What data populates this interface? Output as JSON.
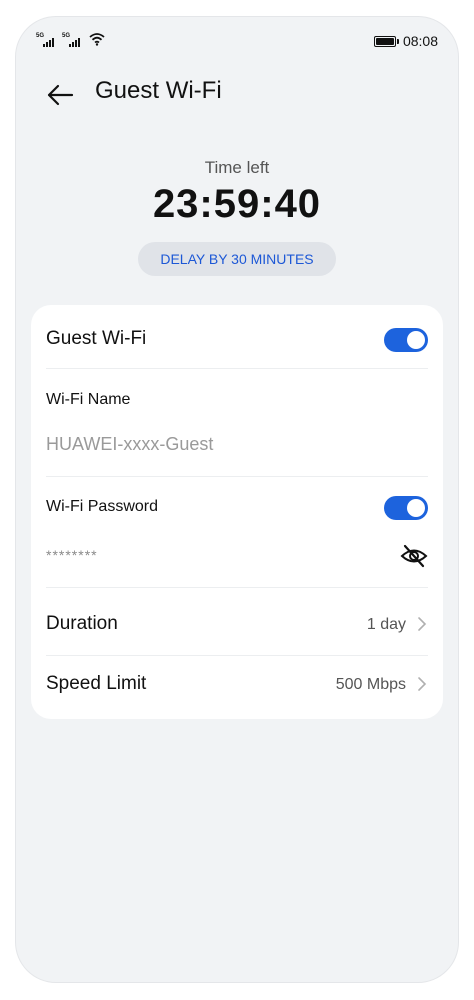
{
  "status_bar": {
    "sim1_tag": "5G",
    "sim2_tag": "5G",
    "time": "08:08",
    "icons": [
      "signal-icon",
      "signal-icon",
      "wifi-icon",
      "battery-icon"
    ]
  },
  "header": {
    "back_icon": "back-arrow-icon",
    "title": "Guest Wi-Fi"
  },
  "timer": {
    "label": "Time left",
    "value": "23:59:40",
    "delay_button": "DELAY BY 30 MINUTES"
  },
  "settings": {
    "guest_wifi": {
      "label": "Guest Wi-Fi",
      "enabled": true
    },
    "wifi_name": {
      "label": "Wi-Fi Name",
      "value": "HUAWEI-xxxx-Guest"
    },
    "wifi_password": {
      "label": "Wi-Fi Password",
      "enabled": true,
      "value": "********",
      "visibility_icon": "eye-off-icon"
    },
    "duration": {
      "label": "Duration",
      "value": "1 day"
    },
    "speed_limit": {
      "label": "Speed Limit",
      "value": "500 Mbps"
    }
  },
  "colors": {
    "accent": "#1d63dd",
    "background": "#f1f3f5",
    "card": "#ffffff"
  }
}
